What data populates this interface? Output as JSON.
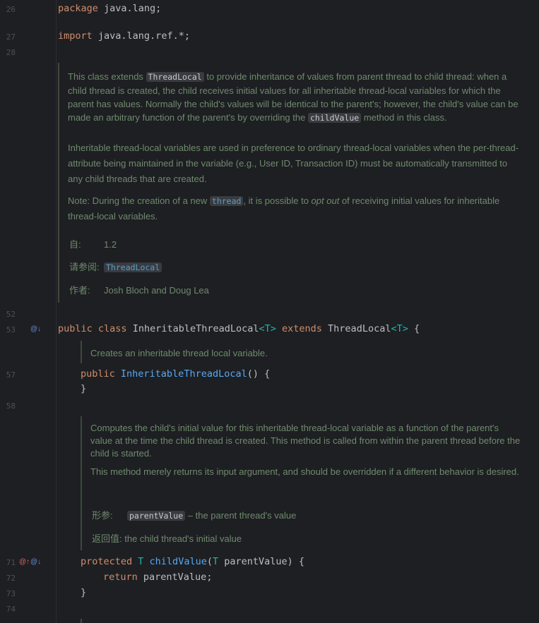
{
  "lines": {
    "l26": "26",
    "l27": "27",
    "l28": "28",
    "l52": "52",
    "l53": "53",
    "l57": "57",
    "l58": "58",
    "l71": "71",
    "l72": "72",
    "l73": "73",
    "l74": "74"
  },
  "code": {
    "package_kw": "package",
    "package_name": " java.lang;",
    "import_kw": "import",
    "import_name": " java.lang.ref.*;",
    "class_public": "public",
    "class_kw": " class",
    "class_name": " InheritableThreadLocal",
    "class_tparam": "<T>",
    "class_extends": " extends",
    "class_super": " ThreadLocal",
    "class_super_tparam": "<T>",
    "class_open": " {",
    "ctor_public": "public",
    "ctor_name": " InheritableThreadLocal",
    "ctor_rest": "() {",
    "ctor_close": "}",
    "m_protected": "protected",
    "m_T": " T",
    "m_name": " childValue",
    "m_params_open": "(",
    "m_param_type": "T",
    "m_params_rest": " parentValue) {",
    "ret_kw": "return",
    "ret_val": " parentValue;",
    "m_close": "}"
  },
  "doc1": {
    "p1_a": "This class extends ",
    "p1_chip1": "ThreadLocal",
    "p1_b": " to provide inheritance of values from parent thread to child thread: when a child thread is created, the child receives initial values for all inheritable thread-local variables for which the parent has values. Normally the child's values will be identical to the parent's; however, the child's value can be made an arbitrary function of the parent's by overriding the ",
    "p1_chip2": "childValue",
    "p1_c": " method in this class.",
    "p2": "Inheritable thread-local variables are used in preference to ordinary thread-local variables when the per-thread-attribute being maintained in the variable (e.g., User ID, Transaction ID) must be automatically transmitted to any child threads that are created.",
    "p3_a": "Note: During the creation of a new ",
    "p3_chip": "thread",
    "p3_b": ", it is possible to ",
    "p3_em": "opt out",
    "p3_c": " of receiving initial values for inheritable thread-local variables.",
    "since_label": "自:",
    "since_value": "1.2",
    "see_label": "请参阅:",
    "see_value": "ThreadLocal",
    "author_label": "作者:",
    "author_value": "Josh Bloch and Doug Lea"
  },
  "doc2": {
    "text": "Creates an inheritable thread local variable."
  },
  "doc3": {
    "p1": "Computes the child's initial value for this inheritable thread-local variable as a function of the parent's value at the time the child thread is created. This method is called from within the parent thread before the child is started.",
    "p2": "This method merely returns its input argument, and should be overridden if a different behavior is desired.",
    "param_label": "形参:",
    "param_chip": "parentValue",
    "param_desc": " – the parent thread's value",
    "return_label": "返回值:",
    "return_desc": " the child thread's initial value"
  },
  "icons": {
    "implemented": "@↓",
    "override": "@↑"
  },
  "colors": {
    "background": "#1e1f22",
    "keyword": "#cf8e6d",
    "type_param": "#16baac",
    "function": "#56a8f5",
    "doc_text": "#6f8a6f"
  }
}
